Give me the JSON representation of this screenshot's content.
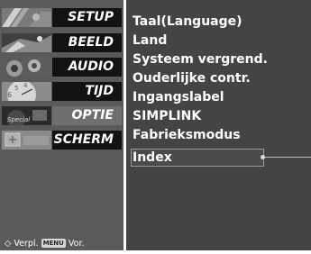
{
  "menu": {
    "items": [
      {
        "label": "SETUP",
        "icon": "setup-icon"
      },
      {
        "label": "BEELD",
        "icon": "picture-icon"
      },
      {
        "label": "AUDIO",
        "icon": "audio-icon"
      },
      {
        "label": "TIJD",
        "icon": "clock-icon"
      },
      {
        "label": "OPTIE",
        "icon": "option-icon",
        "selected": true
      },
      {
        "label": "SCHERM",
        "icon": "screen-icon"
      }
    ]
  },
  "footer": {
    "move_label": "◇ Verpl.",
    "menu_badge": "MENU",
    "prev_label": "Vor."
  },
  "submenu": {
    "items": [
      "Taal(Language)",
      "Land",
      "Systeem vergrend.",
      "Ouderlijke contr.",
      "Ingangslabel",
      "SIMPLINK",
      "Fabrieksmodus",
      "Index"
    ],
    "highlighted_index": 7
  }
}
